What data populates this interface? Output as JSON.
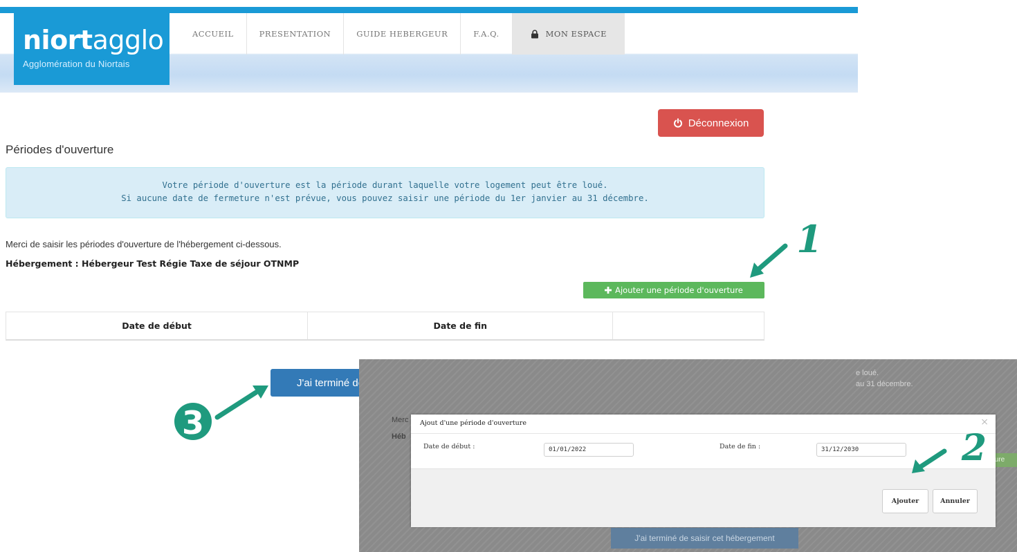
{
  "header": {
    "logo_name_bold": "niort",
    "logo_name_light": "agglo",
    "logo_subtitle": "Agglomération du Niortais",
    "nav": [
      {
        "label": "ACCUEIL"
      },
      {
        "label": "PRESENTATION"
      },
      {
        "label": "GUIDE HEBERGEUR"
      },
      {
        "label": "F.A.Q."
      },
      {
        "label": "MON ESPACE",
        "icon": "lock-icon",
        "active": true
      }
    ],
    "accent_color": "#1a9ad6"
  },
  "logout_label": "Déconnexion",
  "page_title": "Périodes d'ouverture",
  "info": {
    "line1": "Votre période d'ouverture est la période durant laquelle votre logement peut être loué.",
    "line2": "Si aucune date de fermeture n'est prévue, vous pouvez saisir une période du 1er janvier au 31 décembre."
  },
  "intro": "Merci de saisir les périodes d'ouverture de l'hébergement ci-dessous.",
  "lodging": "Hébergement : Hébergeur Test Régie Taxe de séjour OTNMP",
  "add_button": "Ajouter une période d'ouverture",
  "table": {
    "columns": [
      "Date de début",
      "Date de fin",
      ""
    ]
  },
  "done_button": "J'ai terminé de saisir cet hébergement",
  "annotations": [
    "1",
    "2",
    "3"
  ],
  "annotation_color": "#1f9a7e",
  "inset": {
    "bg_text_1": "e loué.",
    "bg_text_2": "au 31 décembre.",
    "bg_merci": "Merc",
    "bg_heb": "Héb",
    "bg_green": "ture",
    "bg_done": "J'ai terminé de saisir cet hébergement",
    "modal": {
      "title": "Ajout d'une période d'ouverture",
      "close": "×",
      "start_label": "Date de début :",
      "start_value": "01/01/2022",
      "end_label": "Date de fin :",
      "end_value": "31/12/2030",
      "add_label": "Ajouter",
      "cancel_label": "Annuler"
    }
  },
  "colors": {
    "danger": "#d9534f",
    "success": "#5cb85c",
    "primary": "#337ab7",
    "info_bg": "#d9edf7"
  }
}
